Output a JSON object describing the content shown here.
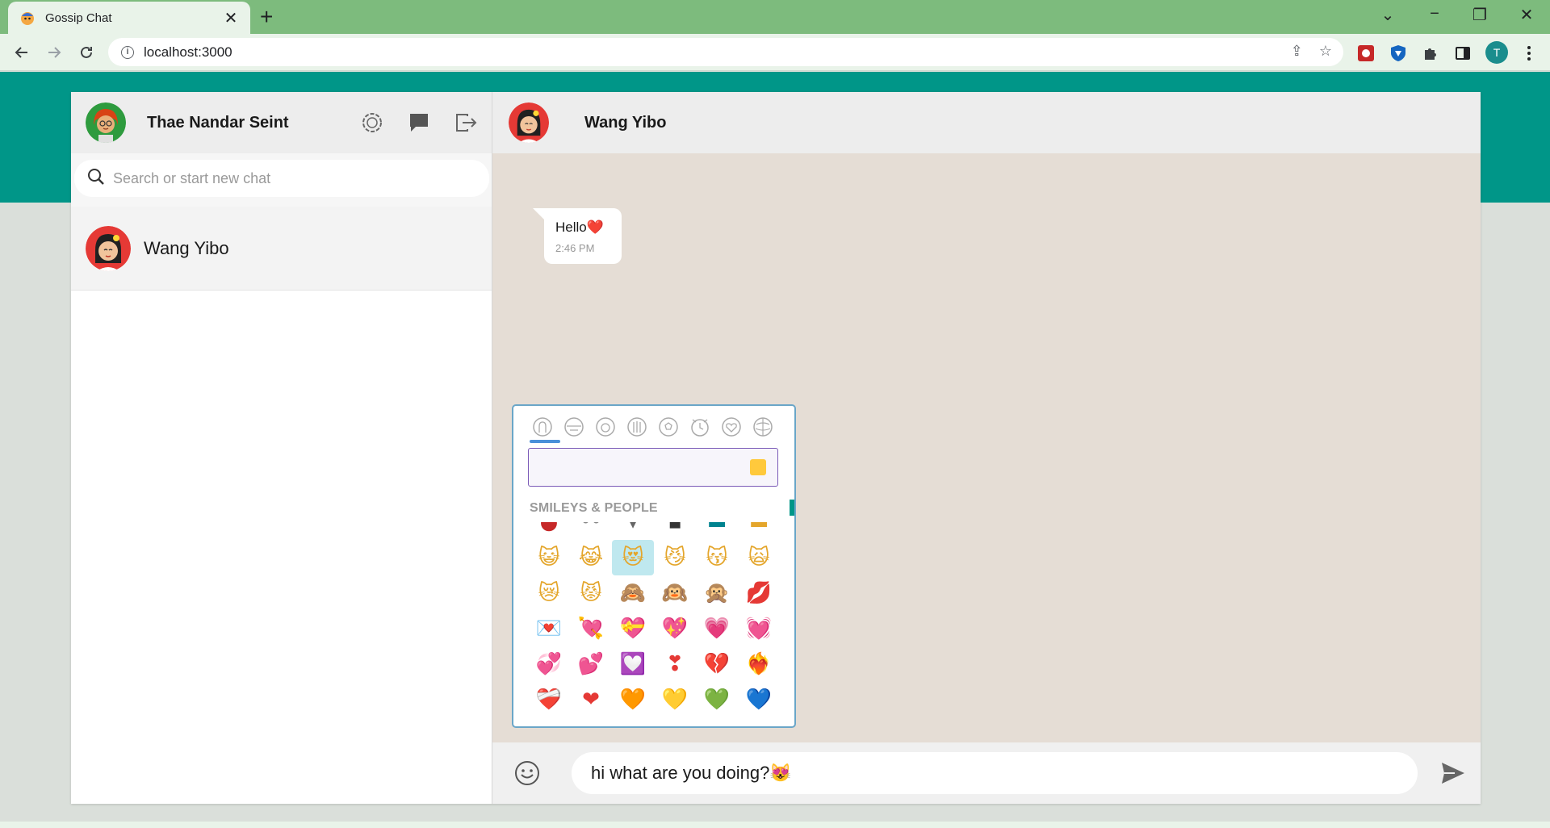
{
  "browser": {
    "tab_title": "Gossip Chat",
    "url": "localhost:3000",
    "profile_initial": "T"
  },
  "sidebar": {
    "user_name": "Thae Nandar Seint",
    "search_placeholder": "Search or start new chat",
    "contacts": [
      {
        "name": "Wang Yibo"
      }
    ]
  },
  "chat": {
    "contact_name": "Wang Yibo",
    "messages": [
      {
        "text": "Hello❤️",
        "time": "2:46 PM"
      }
    ]
  },
  "emoji_picker": {
    "section_title": "SMILEYS & PEOPLE",
    "categories": [
      "smileys-people",
      "animals-nature",
      "food-drink",
      "travel-places",
      "activities",
      "objects",
      "symbols",
      "flags"
    ],
    "active_category": "smileys-people",
    "rows": [
      [
        "😺",
        "😹",
        "😻",
        "😼",
        "😽",
        "🙀"
      ],
      [
        "😿",
        "😾",
        "🙈",
        "🙉",
        "🙊",
        "💋"
      ],
      [
        "💌",
        "💘",
        "💝",
        "💖",
        "💗",
        "💓"
      ],
      [
        "💞",
        "💕",
        "💟",
        "❣",
        "💔",
        "❤‍🔥"
      ],
      [
        "❤‍🩹",
        "❤",
        "🧡",
        "💛",
        "💚",
        "💙"
      ]
    ],
    "selected_emoji": "😻"
  },
  "composer": {
    "value": "hi what are you doing?😻"
  },
  "colors": {
    "tabstrip": "#7dbb7d",
    "brand_teal": "#009688",
    "chat_background": "#e5ddd5",
    "picker_border": "#6aa6c8"
  }
}
